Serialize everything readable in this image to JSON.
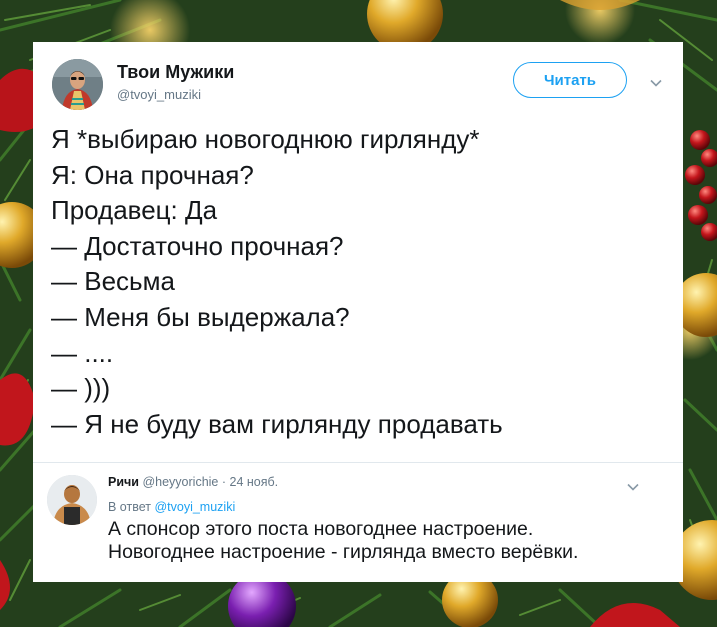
{
  "tweet": {
    "author_name": "Твои Мужики",
    "author_handle": "@tvoyi_muziki",
    "follow_label": "Читать",
    "lines": [
      "Я *выбираю новогоднюю гирлянду*",
      "Я: Она прочная?",
      "Продавец: Да",
      "— Достаточно прочная?",
      "— Весьма",
      "— Меня бы выдержала?",
      "— ....",
      "— )))",
      "— Я не буду вам гирлянду продавать"
    ]
  },
  "reply": {
    "author_name": "Ричи",
    "author_handle": "@heyyorichie",
    "separator": "·",
    "date": "24 нояб.",
    "reply_to_label": "В ответ",
    "reply_to_handle": "@tvoyi_muziki",
    "lines": [
      "А спонсор этого поста новогоднее настроение.",
      "Новогоднее настроение - гирлянда вместо верёвки."
    ]
  },
  "colors": {
    "accent": "#1da1f2",
    "text": "#14171a",
    "muted": "#657786"
  },
  "icons": [
    "chevron-down-icon"
  ]
}
